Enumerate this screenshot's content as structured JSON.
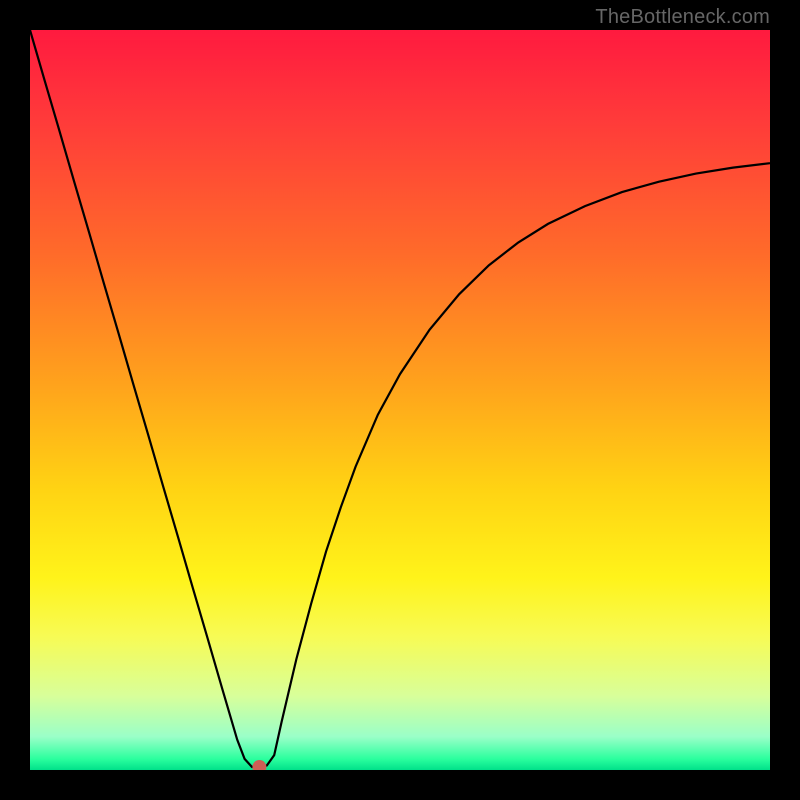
{
  "watermark": "TheBottleneck.com",
  "chart_data": {
    "type": "line",
    "title": "",
    "xlabel": "",
    "ylabel": "",
    "xlim": [
      0,
      100
    ],
    "ylim": [
      0,
      100
    ],
    "background_gradient": {
      "stops": [
        {
          "offset": 0.0,
          "color": "#ff1a3f"
        },
        {
          "offset": 0.12,
          "color": "#ff3a3a"
        },
        {
          "offset": 0.3,
          "color": "#ff6a2a"
        },
        {
          "offset": 0.48,
          "color": "#ffa31c"
        },
        {
          "offset": 0.62,
          "color": "#ffd313"
        },
        {
          "offset": 0.74,
          "color": "#fff31a"
        },
        {
          "offset": 0.82,
          "color": "#f7fb55"
        },
        {
          "offset": 0.9,
          "color": "#d8ff9a"
        },
        {
          "offset": 0.955,
          "color": "#9affc8"
        },
        {
          "offset": 0.985,
          "color": "#2bff9e"
        },
        {
          "offset": 1.0,
          "color": "#00e18a"
        }
      ]
    },
    "series": [
      {
        "name": "bottleneck-curve",
        "color": "#000000",
        "x": [
          0.0,
          2.0,
          4.0,
          6.0,
          8.0,
          10.0,
          12.0,
          14.0,
          16.0,
          18.0,
          20.0,
          22.0,
          24.0,
          26.0,
          28.0,
          29.0,
          30.0,
          31.0,
          32.0,
          33.0,
          34.0,
          36.0,
          38.0,
          40.0,
          42.0,
          44.0,
          47.0,
          50.0,
          54.0,
          58.0,
          62.0,
          66.0,
          70.0,
          75.0,
          80.0,
          85.0,
          90.0,
          95.0,
          100.0
        ],
        "y": [
          100.0,
          93.1,
          86.3,
          79.4,
          72.6,
          65.7,
          58.9,
          52.0,
          45.2,
          38.3,
          31.5,
          24.6,
          17.8,
          10.9,
          4.1,
          1.5,
          0.4,
          0.4,
          0.6,
          2.0,
          6.5,
          15.0,
          22.5,
          29.5,
          35.5,
          41.0,
          48.0,
          53.5,
          59.5,
          64.3,
          68.2,
          71.3,
          73.8,
          76.2,
          78.1,
          79.5,
          80.6,
          81.4,
          82.0
        ]
      }
    ],
    "marker": {
      "name": "optimal-point",
      "x": 31.0,
      "y": 0.4,
      "color": "#cc5e55",
      "radius": 7
    }
  }
}
